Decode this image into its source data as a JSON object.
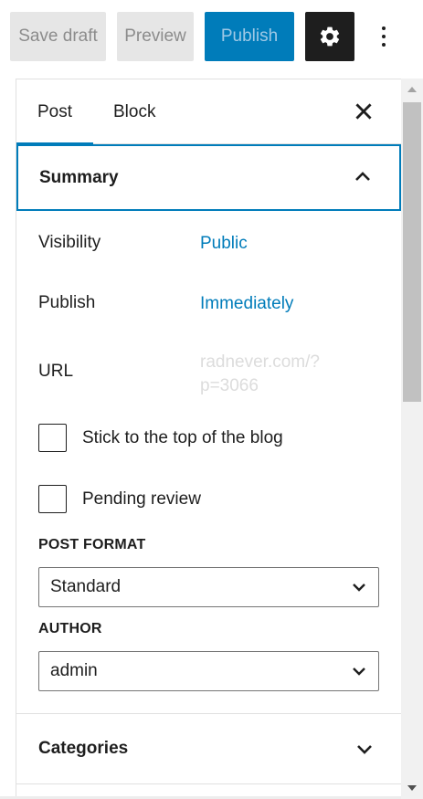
{
  "toolbar": {
    "save_draft_label": "Save draft",
    "preview_label": "Preview",
    "publish_label": "Publish",
    "settings_icon": "gear-icon",
    "more_icon": "vertical-ellipsis-icon"
  },
  "sidebar": {
    "tabs": [
      {
        "label": "Post",
        "active": true
      },
      {
        "label": "Block",
        "active": false
      }
    ],
    "close_icon": "close-icon"
  },
  "summary": {
    "title": "Summary",
    "expanded": true,
    "visibility_label": "Visibility",
    "visibility_value": "Public",
    "publish_label": "Publish",
    "publish_value": "Immediately",
    "url_label": "URL",
    "url_value": "radnever.com/?p=3066",
    "stick_label": "Stick to the top of the blog",
    "stick_checked": false,
    "pending_label": "Pending review",
    "pending_checked": false,
    "post_format_label": "POST FORMAT",
    "post_format_value": "Standard",
    "author_label": "AUTHOR",
    "author_value": "admin"
  },
  "categories": {
    "title": "Categories",
    "expanded": false
  },
  "colors": {
    "accent": "#007cba",
    "dark": "#1e1e1e",
    "disabled_bg": "#e6e6e6"
  }
}
